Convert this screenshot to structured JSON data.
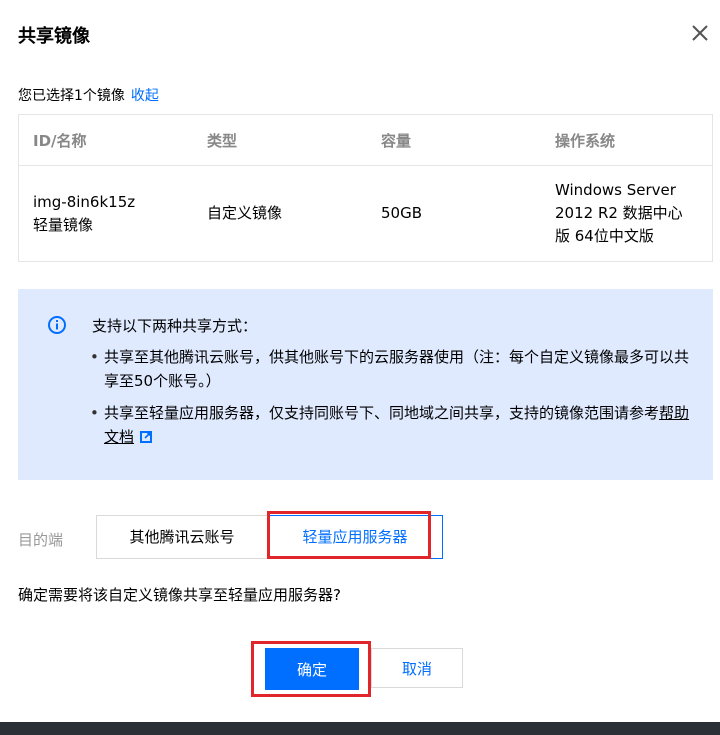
{
  "dialog": {
    "title": "共享镜像",
    "selected_text": "您已选择1个镜像",
    "collapse_link": "收起"
  },
  "table": {
    "headers": [
      "ID/名称",
      "类型",
      "容量",
      "操作系统"
    ],
    "rows": [
      {
        "id": "img-8in6k15z",
        "name": "轻量镜像",
        "type": "自定义镜像",
        "size": "50GB",
        "os": [
          "Windows Server",
          "2012 R2 数据中心",
          "版 64位中文版"
        ]
      }
    ]
  },
  "notice": {
    "icon": "info-icon",
    "heading": "支持以下两种共享方式：",
    "item1": "共享至其他腾讯云账号，供其他账号下的云服务器使用（注：每个自定义镜像最多可以共享至50个账号。）",
    "item2_prefix": "共享至轻量应用服务器，仅支持同账号下、同地域之间共享，支持的镜像范围请参考",
    "help_link": "帮助文档"
  },
  "destination": {
    "label": "目的端",
    "options": [
      "其他腾讯云账号",
      "轻量应用服务器"
    ],
    "selected": "轻量应用服务器"
  },
  "confirm_question": "确定需要将该自定义镜像共享至轻量应用服务器?",
  "buttons": {
    "ok": "确定",
    "cancel": "取消"
  },
  "colors": {
    "accent": "#006eff",
    "notice_bg": "#dfeaff",
    "highlight": "#e0262a"
  }
}
